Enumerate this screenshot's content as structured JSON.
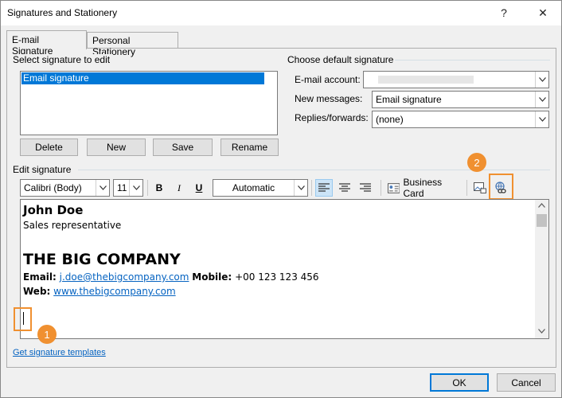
{
  "window": {
    "title": "Signatures and Stationery",
    "help_glyph": "?",
    "close_glyph": "✕"
  },
  "tabs": [
    {
      "label": "E-mail Signature",
      "active": true
    },
    {
      "label": "Personal Stationery",
      "active": false
    }
  ],
  "select_signature": {
    "group_label": "Select signature to edit",
    "items": [
      "Email signature"
    ],
    "buttons": {
      "delete": "Delete",
      "new": "New",
      "save": "Save",
      "rename": "Rename"
    }
  },
  "default_signature": {
    "group_label": "Choose default signature",
    "email_account_label": "E-mail account:",
    "email_account_value": "",
    "new_messages_label": "New messages:",
    "new_messages_value": "Email signature",
    "replies_label": "Replies/forwards:",
    "replies_value": "(none)"
  },
  "edit_signature": {
    "group_label": "Edit signature",
    "toolbar": {
      "font": "Calibri (Body)",
      "size": "11",
      "bold": "B",
      "italic": "I",
      "underline": "U",
      "color": "Automatic",
      "business_card": "Business Card"
    },
    "content": {
      "name": "John Doe",
      "title": "Sales representative",
      "company": "THE BIG COMPANY",
      "email_label": "Email:",
      "email": "j.doe@thebigcompany.com",
      "mobile_label": "Mobile:",
      "mobile": "+00 123 123 456",
      "web_label": "Web:",
      "web": "www.thebigcompany.com"
    }
  },
  "get_templates_link": "Get signature templates",
  "footer": {
    "ok": "OK",
    "cancel": "Cancel"
  },
  "callouts": {
    "one": "1",
    "two": "2"
  },
  "colors": {
    "accent": "#0078d7",
    "callout": "#f09030",
    "link": "#0563c1"
  },
  "icons": [
    "help-icon",
    "close-icon",
    "align-left-icon",
    "align-center-icon",
    "align-right-icon",
    "business-card-icon",
    "insert-picture-icon",
    "insert-hyperlink-icon",
    "chevron-down-icon"
  ]
}
